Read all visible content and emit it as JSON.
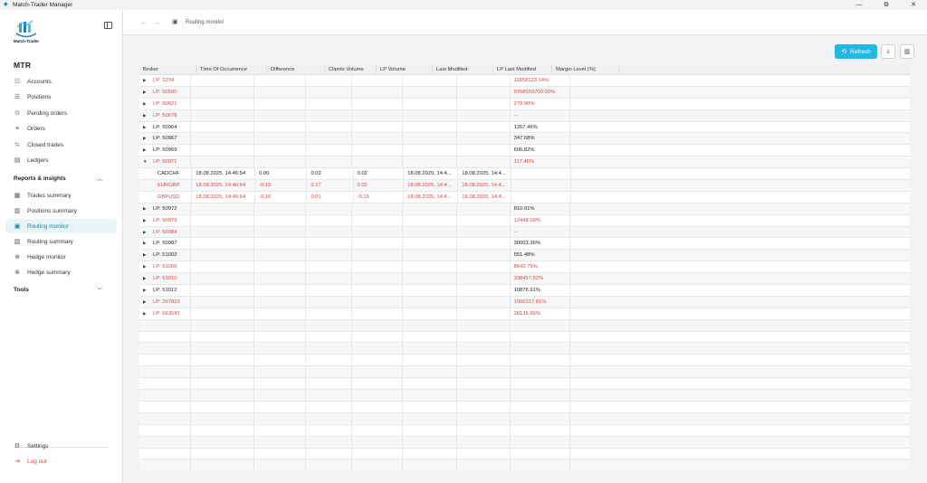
{
  "window": {
    "title": "Match-Trader Manager",
    "controls": [
      "—",
      "⧉",
      "✕"
    ]
  },
  "sidebar": {
    "logo_text": "Match-Trader",
    "org": "MTR",
    "items": [
      {
        "label": "Accounts",
        "icon": "accounts-icon",
        "glyph": "☷"
      },
      {
        "label": "Positions",
        "icon": "positions-icon",
        "glyph": "☰"
      },
      {
        "label": "Pending orders",
        "icon": "pending-orders-icon",
        "glyph": "⊙"
      },
      {
        "label": "Orders",
        "icon": "orders-icon",
        "glyph": "≡"
      },
      {
        "label": "Closed trades",
        "icon": "closed-trades-icon",
        "glyph": "≒"
      },
      {
        "label": "Ledgers",
        "icon": "ledgers-icon",
        "glyph": "▤"
      }
    ],
    "reports_section": "Reports & insights",
    "reports": [
      {
        "label": "Trades summary",
        "icon": "trades-summary-icon",
        "glyph": "▦"
      },
      {
        "label": "Positions summary",
        "icon": "positions-summary-icon",
        "glyph": "▥"
      },
      {
        "label": "Routing monitor",
        "icon": "routing-monitor-icon",
        "glyph": "▣"
      },
      {
        "label": "Routing summary",
        "icon": "routing-summary-icon",
        "glyph": "▧"
      },
      {
        "label": "Hedge monitor",
        "icon": "hedge-monitor-icon",
        "glyph": "⊕"
      },
      {
        "label": "Hedge summary",
        "icon": "hedge-summary-icon",
        "glyph": "⊗"
      }
    ],
    "tools_section": "Tools",
    "settings": "Settings",
    "logout": "Log out"
  },
  "topbar": {
    "back": "←",
    "forward": "→",
    "breadcrumb": "Routing monitor"
  },
  "toolbar": {
    "refresh": "Refresh",
    "refresh_glyph": "⟲",
    "download_glyph": "⤓",
    "columns_glyph": "▥"
  },
  "colors": {
    "accent": "#23b8e2",
    "negative": "#d64545",
    "active_bg": "#e9f4f9"
  },
  "table": {
    "columns": [
      "Broker",
      "Time Of Occurrence",
      "Difference",
      "Clients Volume",
      "LP Volume",
      "Last Modified",
      "LP Last Modified",
      "Margin Level (%)"
    ],
    "rows": [
      {
        "type": "lp",
        "expanded": false,
        "red": true,
        "broker": "LP: 1234",
        "margin": "11858123.14%"
      },
      {
        "type": "lp",
        "expanded": false,
        "red": true,
        "broker": "LP: 50500",
        "margin": "9768559700.00%"
      },
      {
        "type": "lp",
        "expanded": false,
        "red": true,
        "broker": "LP: 50621",
        "margin": "279.90%"
      },
      {
        "type": "lp",
        "expanded": false,
        "red": true,
        "broker": "LP: 50678",
        "margin": "--"
      },
      {
        "type": "lp",
        "expanded": false,
        "red": false,
        "broker": "LP: 50964",
        "margin": "1267.46%"
      },
      {
        "type": "lp",
        "expanded": false,
        "red": false,
        "broker": "LP: 50967",
        "margin": "347.68%"
      },
      {
        "type": "lp",
        "expanded": false,
        "red": false,
        "broker": "LP: 50969",
        "margin": "606.82%"
      },
      {
        "type": "lp",
        "expanded": true,
        "red": true,
        "broker": "LP: 50971",
        "margin": "117.46%"
      },
      {
        "type": "child",
        "red": false,
        "broker": "CADCHF",
        "time": "18.08.2025, 14:46:54",
        "diff": "0.00",
        "clients": "0.02",
        "lp": "0.02",
        "last": "18.08.2025, 14:4...",
        "lplast": "18.08.2025, 14:4...",
        "margin": ""
      },
      {
        "type": "child",
        "red": true,
        "broker": "EURGBP",
        "time": "18.08.2025, 14:46:54",
        "diff": "-0.15",
        "clients": "0.17",
        "lp": "0.02",
        "last": "18.08.2025, 14:4...",
        "lplast": "18.08.2025, 14:4...",
        "margin": ""
      },
      {
        "type": "child",
        "red": true,
        "broker": "GBPUSD",
        "time": "18.08.2025, 14:46:54",
        "diff": "-0.16",
        "clients": "0.01",
        "lp": "-0.15",
        "last": "18.08.2025, 14:4...",
        "lplast": "18.08.2025, 14:4...",
        "margin": ""
      },
      {
        "type": "lp",
        "expanded": false,
        "red": false,
        "broker": "LP: 50972",
        "margin": "810.01%"
      },
      {
        "type": "lp",
        "expanded": false,
        "red": true,
        "broker": "LP: 50979",
        "margin": "12448.68%"
      },
      {
        "type": "lp",
        "expanded": false,
        "red": true,
        "broker": "LP: 50984",
        "margin": "--"
      },
      {
        "type": "lp",
        "expanded": false,
        "red": false,
        "broker": "LP: 50987",
        "margin": "30003.36%"
      },
      {
        "type": "lp",
        "expanded": false,
        "red": false,
        "broker": "LP: 51002",
        "margin": "551.48%"
      },
      {
        "type": "lp",
        "expanded": false,
        "red": true,
        "broker": "LP: 51006",
        "margin": "8643.75%"
      },
      {
        "type": "lp",
        "expanded": false,
        "red": true,
        "broker": "LP: 51010",
        "margin": "338457.52%"
      },
      {
        "type": "lp",
        "expanded": false,
        "red": false,
        "broker": "LP: 51012",
        "margin": "10876.91%"
      },
      {
        "type": "lp",
        "expanded": false,
        "red": true,
        "broker": "LP: 267823",
        "margin": "1066317.81%"
      },
      {
        "type": "lp",
        "expanded": false,
        "red": true,
        "broker": "LP: 663541",
        "margin": "28136.96%"
      }
    ]
  }
}
